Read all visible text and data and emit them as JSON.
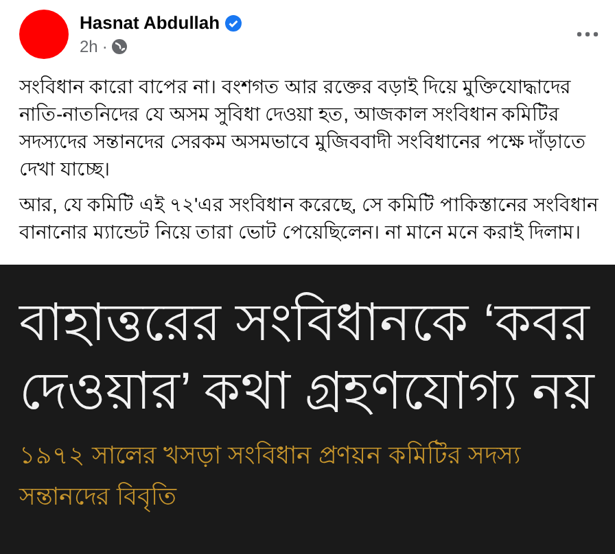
{
  "post": {
    "author": "Hasnat Abdullah",
    "verified": true,
    "time": "2h",
    "separator": "·",
    "paragraphs": [
      "সংবিধান কারো বাপের না। বংশগত আর রক্তের বড়াই দিয়ে মুক্তিযোদ্ধাদের নাতি-নাতনিদের যে অসম সুবিধা দেওয়া হত, আজকাল সংবিধান কমিটির সদস্যদের সন্তানদের সেরকম অসমভাবে মুজিববাদী সংবিধানের পক্ষে দাঁড়াতে দেখা যাচ্ছে।",
      "আর, যে কমিটি এই ৭২'এর সংবিধান করেছে, সে কমিটি পাকিস্তানের সংবিধান বানানোর ম্যান্ডেট নিয়ে তারা ভোট পেয়েছিলেন। না মানে মনে করাই দিলাম।"
    ],
    "image": {
      "headline": "বাহাত্তরের সংবিধানকে ‘কবর দেওয়ার’ কথা গ্রহণযোগ্য নয়",
      "subheadline": "১৯৭২ সালের খসড়া সংবিধান প্রণয়ন কমিটির সদস্য সন্তানদের বিবৃতি"
    }
  }
}
